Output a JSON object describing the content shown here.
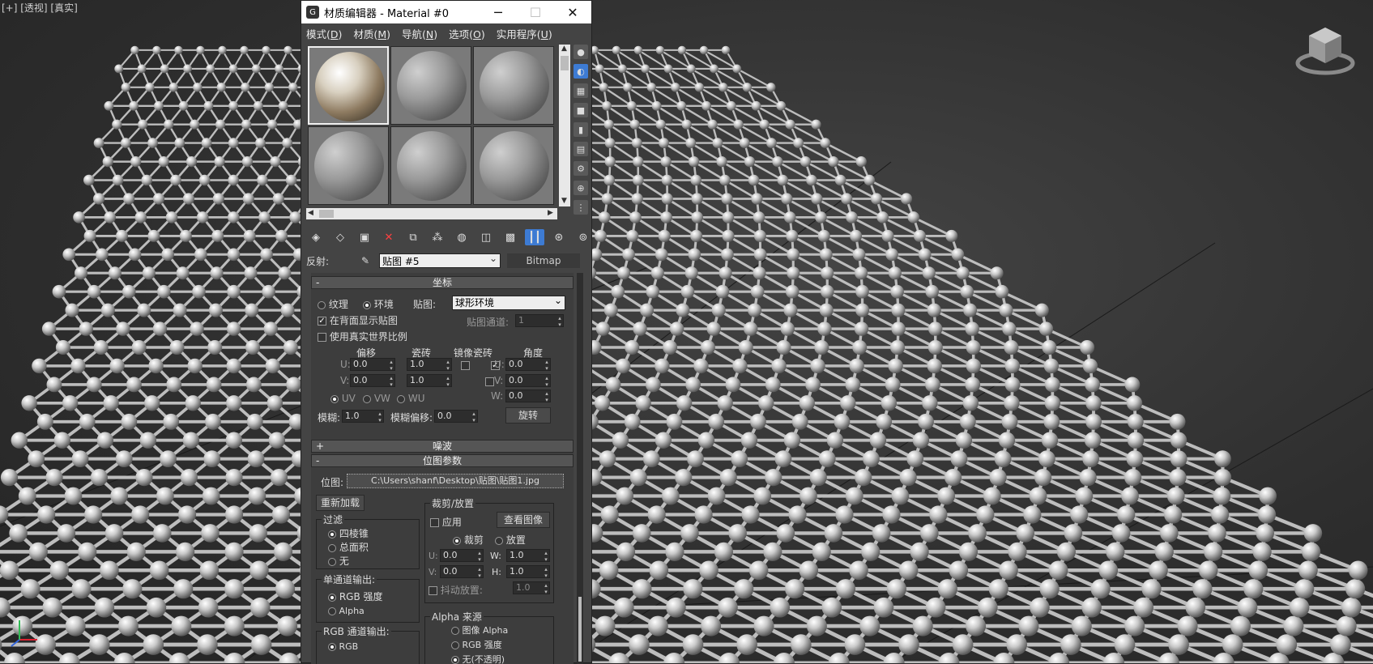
{
  "viewport": {
    "label": "[+] [透视] [真实]"
  },
  "editor": {
    "title": "材质编辑器 - Material #0",
    "menu": [
      {
        "text": "模式(",
        "key": "D",
        "end": ")"
      },
      {
        "text": "材质(",
        "key": "M",
        "end": ")"
      },
      {
        "text": "导航(",
        "key": "N",
        "end": ")"
      },
      {
        "text": "选项(",
        "key": "O",
        "end": ")"
      },
      {
        "text": "实用程序(",
        "key": "U",
        "end": ")"
      }
    ],
    "reflection": {
      "label": "反射:",
      "map_name": "贴图 #5",
      "map_type": "Bitmap"
    },
    "coords": {
      "title": "坐标",
      "texture_label": "纹理",
      "environ_label": "环境",
      "mapping_label": "贴图:",
      "mapping_value": "球形环境",
      "show_back": "在背面显示贴图",
      "real_world": "使用真实世界比例",
      "channel_label": "贴图通道:",
      "channel_value": "1",
      "hdr_offset": "偏移",
      "hdr_tiling": "瓷砖",
      "hdr_mirror": "镜像",
      "hdr_tile": "瓷砖",
      "hdr_angle": "角度",
      "u_label": "U:",
      "v_label": "V:",
      "w_label": "W:",
      "u_offset": "0.0",
      "v_offset": "0.0",
      "u_tiling": "1.0",
      "v_tiling": "1.0",
      "u_angle": "0.0",
      "v_angle": "0.0",
      "w_angle": "0.0",
      "uv": "UV",
      "vw": "VW",
      "wu": "WU",
      "blur_label": "模糊:",
      "blur_value": "1.0",
      "blur_offset_label": "模糊偏移:",
      "blur_offset_value": "0.0",
      "rotate_btn": "旋转"
    },
    "noise": {
      "title": "噪波"
    },
    "bitmap": {
      "title": "位图参数",
      "bitmap_label": "位图:",
      "path": "C:\\Users\\shanf\\Desktop\\贴图\\贴图1.jpg",
      "reload": "重新加载",
      "crop_group": "裁剪/放置",
      "apply": "应用",
      "view_image": "查看图像",
      "crop": "裁剪",
      "place": "放置",
      "u_label": "U:",
      "v_label": "V:",
      "w_label": "W:",
      "h_label": "H:",
      "u_value": "0.0",
      "v_value": "0.0",
      "w_value": "1.0",
      "h_value": "1.0",
      "jitter": "抖动放置:",
      "jitter_value": "1.0",
      "filter_group": "过滤",
      "pyramidal": "四棱锥",
      "summed_area": "总面积",
      "none": "无",
      "mono_group": "单通道输出:",
      "rgb_intensity": "RGB 强度",
      "alpha": "Alpha",
      "rgb_group": "RGB 通道输出:",
      "rgb": "RGB",
      "alpha_src_group": "Alpha 来源",
      "image_alpha": "图像 Alpha",
      "rgb_intensity2": "RGB 强度",
      "none_opaque": "无(不透明)"
    }
  }
}
